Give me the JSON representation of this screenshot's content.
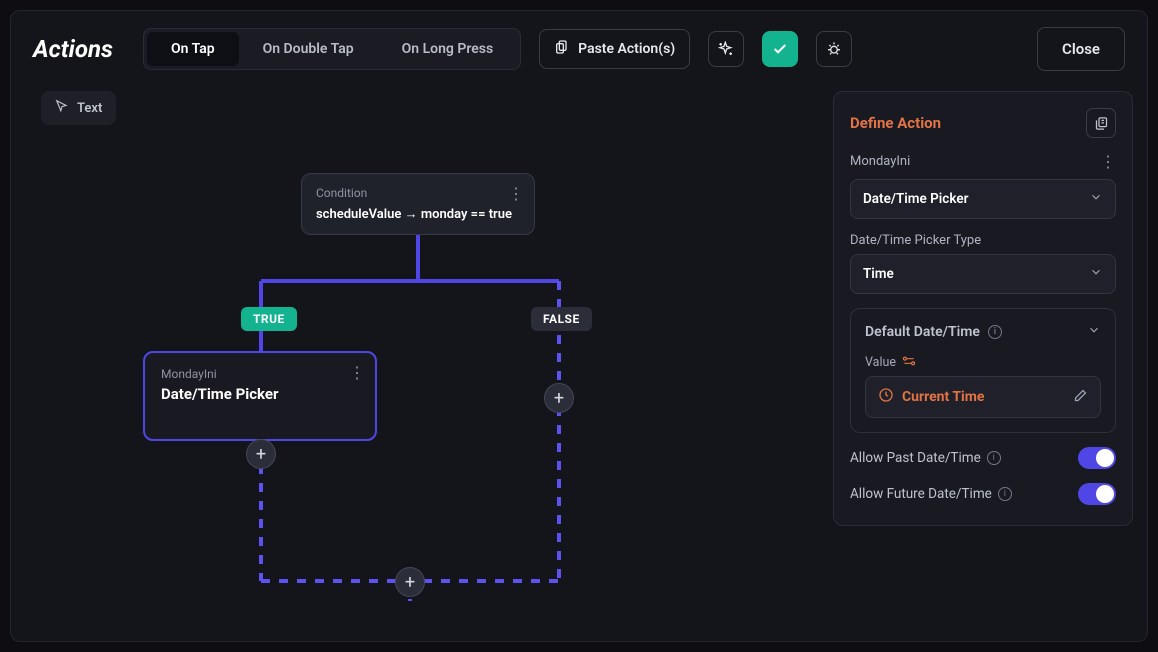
{
  "header": {
    "title": "Actions",
    "tabs": [
      "On Tap",
      "On Double Tap",
      "On Long Press"
    ],
    "active_tab": 0,
    "paste_label": "Paste Action(s)",
    "close_label": "Close"
  },
  "toolbar_chip": {
    "label": "Text"
  },
  "canvas": {
    "condition": {
      "label": "Condition",
      "expression": "scheduleValue → monday  ==  true"
    },
    "true_badge": "TRUE",
    "false_badge": "FALSE",
    "selected_node": {
      "subtitle": "MondayIni",
      "title": "Date/Time Picker"
    }
  },
  "panel": {
    "title": "Define Action",
    "node_name": "MondayIni",
    "action_select": "Date/Time Picker",
    "type_label": "Date/Time Picker Type",
    "type_select": "Time",
    "default_section_label": "Default Date/Time",
    "value_label": "Value",
    "value_text": "Current Time",
    "allow_past_label": "Allow Past Date/Time",
    "allow_past": true,
    "allow_future_label": "Allow Future Date/Time",
    "allow_future": true
  }
}
